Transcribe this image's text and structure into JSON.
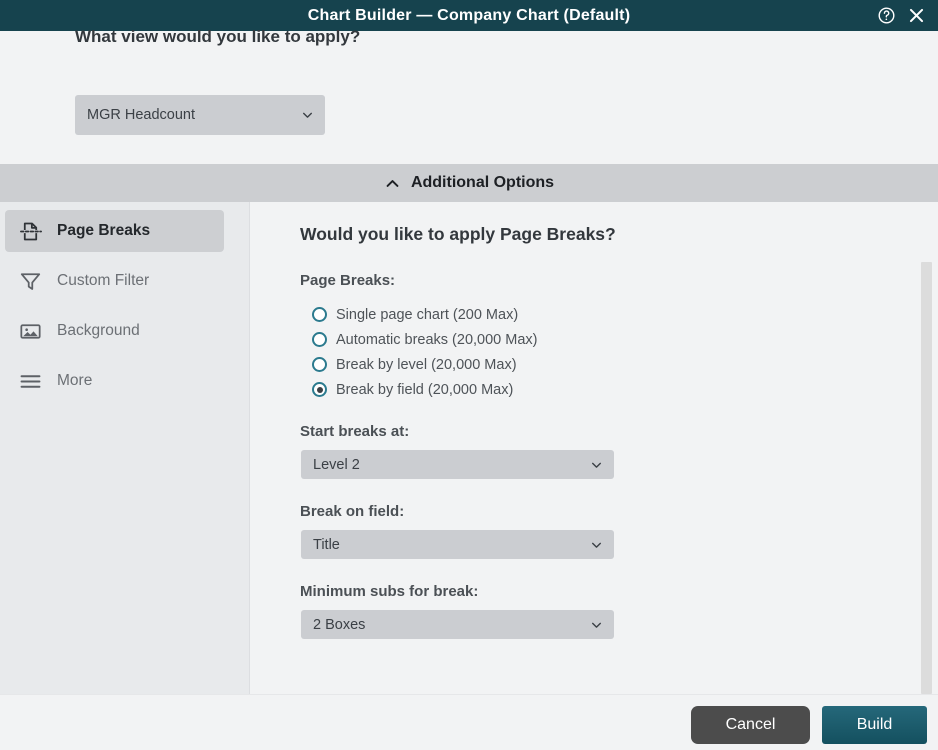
{
  "titlebar": {
    "title": "Chart Builder — Company Chart (Default)",
    "help_icon": "help-circle-icon",
    "close_icon": "close-icon"
  },
  "upper_section": {
    "question": "What view would you like to apply?",
    "view_select": {
      "value": "MGR Headcount",
      "chevron_icon": "chevron-down-icon"
    }
  },
  "additional_options": {
    "label": "Additional Options",
    "chevron_icon": "chevron-up-icon",
    "expanded": true
  },
  "sidebar": {
    "items": [
      {
        "label": "Page Breaks",
        "icon": "page-break-icon",
        "active": true
      },
      {
        "label": "Custom Filter",
        "icon": "funnel-icon",
        "active": false
      },
      {
        "label": "Background",
        "icon": "image-icon",
        "active": false
      },
      {
        "label": "More",
        "icon": "menu-icon",
        "active": false
      }
    ]
  },
  "content": {
    "heading": "Would you like to apply Page Breaks?",
    "page_breaks": {
      "label": "Page Breaks:",
      "options": [
        {
          "label": "Single page chart (200 Max)",
          "selected": false
        },
        {
          "label": "Automatic breaks (20,000 Max)",
          "selected": false
        },
        {
          "label": "Break by level (20,000 Max)",
          "selected": false
        },
        {
          "label": "Break by field (20,000 Max)",
          "selected": true
        }
      ]
    },
    "start_breaks_at": {
      "label": "Start breaks at:",
      "value": "Level 2"
    },
    "break_on_field": {
      "label": "Break on field:",
      "value": "Title"
    },
    "minimum_subs": {
      "label": "Minimum subs for break:",
      "value": "2 Boxes"
    }
  },
  "footer": {
    "cancel_label": "Cancel",
    "build_label": "Build"
  },
  "colors": {
    "titlebar": "#16434e",
    "accent_teal": "#2b7a8e",
    "build_button": "#14505f",
    "cancel_button": "#4c4c4c",
    "select_bg": "#cbcdd1",
    "sidebar_bg": "#e8eaec"
  }
}
